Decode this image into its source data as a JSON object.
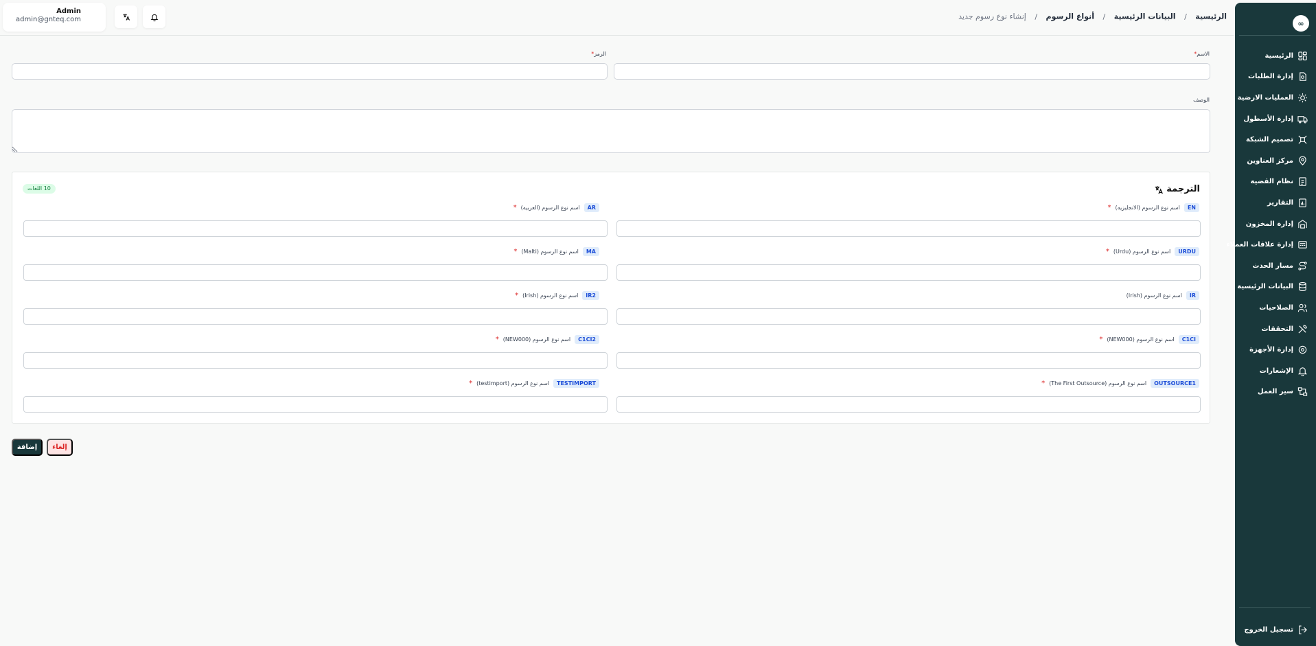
{
  "sidebar": {
    "logo": "∞",
    "items": [
      {
        "label": "الرئيسية",
        "icon": "layout-dashboard-icon"
      },
      {
        "label": "إدارة الطلبات",
        "icon": "orders-icon"
      },
      {
        "label": "العمليات الارضية",
        "icon": "ground-operations-icon"
      },
      {
        "label": "إدارة الأسطول",
        "icon": "truck-icon"
      },
      {
        "label": "تصميم الشبكة",
        "icon": "network-icon"
      },
      {
        "label": "مركز العناوين",
        "icon": "map-pin-icon"
      },
      {
        "label": "نظام القضية",
        "icon": "case-file-icon"
      },
      {
        "label": "التقارير",
        "icon": "report-icon"
      },
      {
        "label": "إدارة المخزون",
        "icon": "warehouse-icon"
      },
      {
        "label": "إدارة علاقات العملاء",
        "icon": "crm-icon"
      },
      {
        "label": "مسار الحدث",
        "icon": "route-icon"
      },
      {
        "label": "البيانات الرئيسية",
        "icon": "database-icon"
      },
      {
        "label": "الصلاحيات",
        "icon": "users-icon"
      },
      {
        "label": "التحققات",
        "icon": "tools-icon"
      },
      {
        "label": "إدارة الأجهزة",
        "icon": "device-icon"
      },
      {
        "label": "الإشعارات",
        "icon": "bell-icon"
      },
      {
        "label": "سير العمل",
        "icon": "workflow-icon"
      }
    ],
    "logout": {
      "label": "تسجيل الخروج",
      "icon": "logout-icon"
    }
  },
  "breadcrumb": [
    {
      "label": "الرئيسية"
    },
    {
      "label": "البيانات الرئيسية"
    },
    {
      "label": "أنواع الرسوم"
    },
    {
      "label": "إنشاء نوع رسوم جديد"
    }
  ],
  "breadcrumb_separator": "/",
  "user": {
    "name": "Admin",
    "email": "admin@gnteq.com"
  },
  "form": {
    "name_label": "الاسم",
    "code_label": "الرمز",
    "description_label": "الوصف",
    "required_mark": "*",
    "name_value": "",
    "code_value": "",
    "description_value": ""
  },
  "translation": {
    "title": "الترجمة",
    "count_badge": "10 اللغات",
    "fields": [
      {
        "code": "EN",
        "label": "اسم نوع الرسوم (الانجليزيه)",
        "required": true
      },
      {
        "code": "AR",
        "label": "اسم نوع الرسوم (العربيه)",
        "required": true
      },
      {
        "code": "URDU",
        "label": "اسم نوع الرسوم (Urdu)",
        "required": true
      },
      {
        "code": "MA",
        "label": "اسم نوع الرسوم (Malti)",
        "required": true
      },
      {
        "code": "IR",
        "label": "اسم نوع الرسوم (Irish)",
        "required": false
      },
      {
        "code": "IR2",
        "label": "اسم نوع الرسوم (Irish)",
        "required": true
      },
      {
        "code": "C1CI",
        "label": "اسم نوع الرسوم (NEW000)",
        "required": true
      },
      {
        "code": "C1CI2",
        "label": "اسم نوع الرسوم (NEW000)",
        "required": true
      },
      {
        "code": "OUTSOURCE1",
        "label": "اسم نوع الرسوم (The First Outsource)",
        "required": true
      },
      {
        "code": "TESTIMPORT",
        "label": "اسم نوع الرسوم (testimport)",
        "required": true
      }
    ]
  },
  "actions": {
    "add_label": "إضافة",
    "cancel_label": "إلغاء"
  },
  "colors": {
    "sidebar": "#19383b",
    "primary": "#19383b",
    "danger": "#dc2626",
    "chip_bg": "#e0ecfb",
    "chip_text": "#1d4ed8",
    "badge_bg": "#dcfce7",
    "badge_text": "#15803d"
  }
}
